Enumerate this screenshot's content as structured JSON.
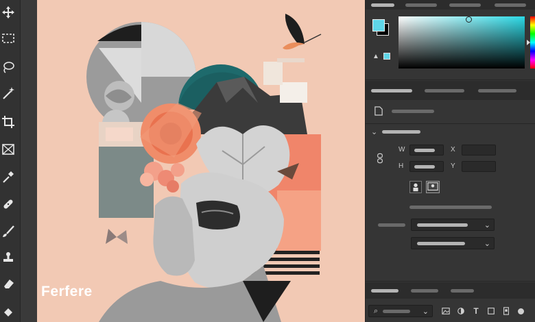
{
  "watermark": {
    "text": "Ferfere"
  },
  "toolbar": {
    "tools": [
      "move-tool",
      "marquee-tool",
      "lasso-tool",
      "magic-wand-tool",
      "crop-tool",
      "frame-tool",
      "eyedropper-tool",
      "healing-brush-tool",
      "brush-tool",
      "clone-stamp-tool",
      "eraser-tool"
    ]
  },
  "panel": {
    "properties": {
      "width_label": "W",
      "height_label": "H",
      "x_label": "X",
      "y_label": "Y"
    },
    "colors": {
      "foreground": "#5fd6e8",
      "background": "#000000",
      "picker_hue": "#2bd9e6"
    },
    "bottom_icons": [
      "search-icon",
      "image-icon",
      "circle-icon",
      "text-icon",
      "shape-icon",
      "smart-object-icon"
    ]
  }
}
